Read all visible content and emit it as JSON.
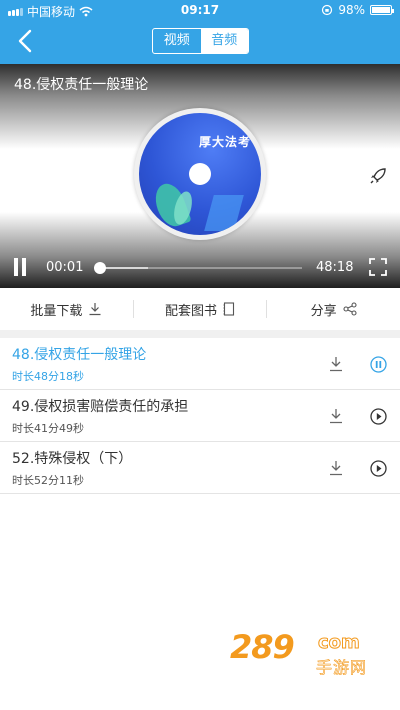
{
  "status_bar": {
    "carrier": "中国移动",
    "time": "09:17",
    "battery": "98%",
    "battery_level": 0.98
  },
  "nav": {
    "tabs": [
      {
        "label": "视频",
        "selected": false
      },
      {
        "label": "音频",
        "selected": true
      }
    ]
  },
  "player": {
    "title": "48.侵权责任一般理论",
    "disc_brand": "厚大法考",
    "current_time": "00:01",
    "duration": "48:18",
    "progress": 0.0003,
    "state": "playing"
  },
  "actions": {
    "batch_download": "批量下载",
    "books": "配套图书",
    "share": "分享"
  },
  "episodes": [
    {
      "title": "48.侵权责任一般理论",
      "duration": "时长48分18秒",
      "active": true,
      "state": "playing"
    },
    {
      "title": "49.侵权损害赔偿责任的承担",
      "duration": "时长41分49秒",
      "active": false,
      "state": "paused"
    },
    {
      "title": "52.特殊侵权（下）",
      "duration": "时长52分11秒",
      "active": false,
      "state": "paused"
    }
  ],
  "watermark": {
    "number": "289",
    "domain": "com",
    "site": "手游网"
  },
  "colors": {
    "accent": "#35a4e6",
    "watermark": "#f39a1e",
    "text": "#333333"
  }
}
